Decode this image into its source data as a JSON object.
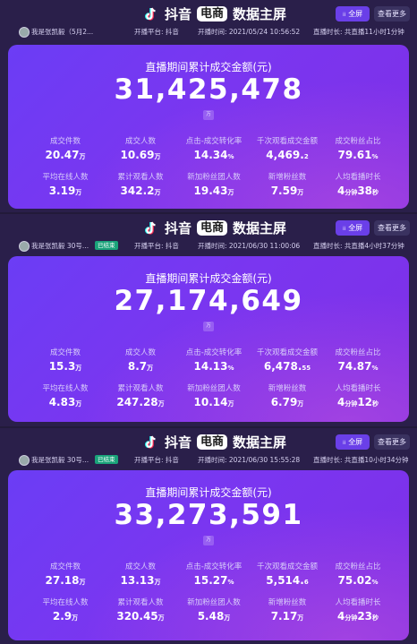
{
  "common": {
    "brand_text": "抖音",
    "brand_badge": "电商",
    "brand_title": "数据主屏",
    "btn_full": "全屏",
    "btn_more": "查看更多",
    "total_label": "直播期间累计成交金额(元)",
    "wan": "万",
    "labels": [
      "成交件数",
      "成交人数",
      "点击-成交转化率",
      "千次观看成交金额",
      "成交粉丝占比",
      "平均在线人数",
      "累计观看人数",
      "新加粉丝团人数",
      "新增粉丝数",
      "人均看播时长"
    ],
    "colors": {
      "accent": "#6a3fe8",
      "card_start": "#6b3df5",
      "card_end": "#7f2fe6",
      "status": "#1aa37a"
    }
  },
  "panels": [
    {
      "anchor": "我是张凯毅（5月2...",
      "status": "",
      "platform": "开播平台: 抖音",
      "start_time": "开播时间: 2021/05/24 10:56:52",
      "duration": "直播时长: 共直播11小时1分钟",
      "total": "31,425,478",
      "stats": [
        {
          "num": "20.47",
          "unit": "万"
        },
        {
          "num": "10.69",
          "unit": "万"
        },
        {
          "num": "14.34",
          "unit": "%"
        },
        {
          "num": "4,469.",
          "unit": "2"
        },
        {
          "num": "79.61",
          "unit": "%"
        },
        {
          "num": "3.19",
          "unit": "万"
        },
        {
          "num": "342.2",
          "unit": "万"
        },
        {
          "num": "19.43",
          "unit": "万"
        },
        {
          "num": "7.59",
          "unit": "万"
        },
        {
          "num": "4",
          "unit": "分钟",
          "num2": "38",
          "unit2": "秒"
        }
      ]
    },
    {
      "anchor": "我是张凯毅 30号...",
      "status": "已结束",
      "platform": "开播平台: 抖音",
      "start_time": "开播时间: 2021/06/30 11:00:06",
      "duration": "直播时长: 共直播4小时37分钟",
      "total": "27,174,649",
      "stats": [
        {
          "num": "15.3",
          "unit": "万"
        },
        {
          "num": "8.7",
          "unit": "万"
        },
        {
          "num": "14.13",
          "unit": "%"
        },
        {
          "num": "6,478.",
          "unit": "55"
        },
        {
          "num": "74.87",
          "unit": "%"
        },
        {
          "num": "4.83",
          "unit": "万"
        },
        {
          "num": "247.28",
          "unit": "万"
        },
        {
          "num": "10.14",
          "unit": "万"
        },
        {
          "num": "6.79",
          "unit": "万"
        },
        {
          "num": "4",
          "unit": "分钟",
          "num2": "12",
          "unit2": "秒"
        }
      ]
    },
    {
      "anchor": "我是张凯毅 30号...",
      "status": "已结束",
      "platform": "开播平台: 抖音",
      "start_time": "开播时间: 2021/06/30 15:55:28",
      "duration": "直播时长: 共直播10小时34分钟",
      "total": "33,273,591",
      "stats": [
        {
          "num": "27.18",
          "unit": "万"
        },
        {
          "num": "13.13",
          "unit": "万"
        },
        {
          "num": "15.27",
          "unit": "%"
        },
        {
          "num": "5,514.",
          "unit": "6"
        },
        {
          "num": "75.02",
          "unit": "%"
        },
        {
          "num": "2.9",
          "unit": "万"
        },
        {
          "num": "320.45",
          "unit": "万"
        },
        {
          "num": "5.48",
          "unit": "万"
        },
        {
          "num": "7.17",
          "unit": "万"
        },
        {
          "num": "4",
          "unit": "分钟",
          "num2": "23",
          "unit2": "秒"
        }
      ]
    }
  ]
}
